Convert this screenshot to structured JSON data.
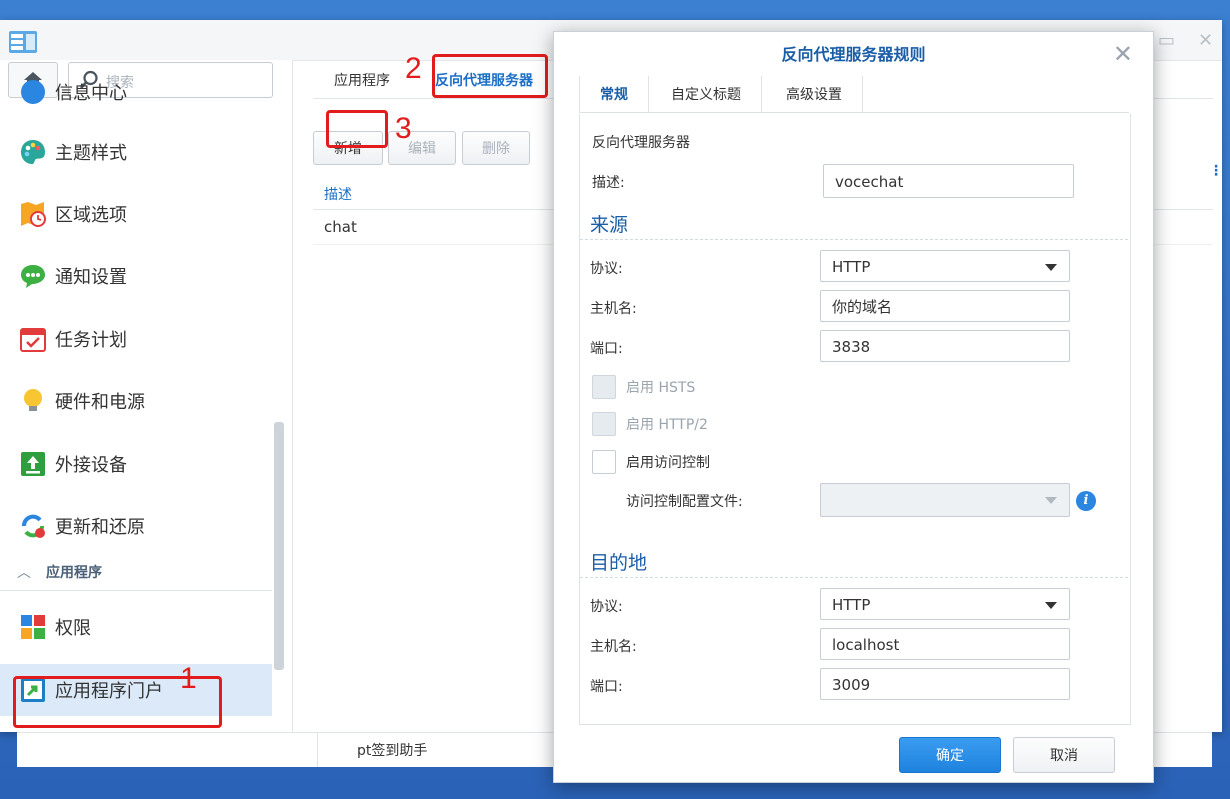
{
  "window": {
    "controls": {
      "minimize": "▭",
      "close": "✕"
    }
  },
  "sidebar": {
    "search_placeholder": "搜索",
    "items": [
      {
        "label": "信息中心",
        "icon": "info-center-icon"
      },
      {
        "label": "主题样式",
        "icon": "palette-icon"
      },
      {
        "label": "区域选项",
        "icon": "region-map-icon"
      },
      {
        "label": "通知设置",
        "icon": "chat-bubble-icon"
      },
      {
        "label": "任务计划",
        "icon": "calendar-check-icon"
      },
      {
        "label": "硬件和电源",
        "icon": "lightbulb-icon"
      },
      {
        "label": "外接设备",
        "icon": "external-device-icon"
      },
      {
        "label": "更新和还原",
        "icon": "update-restore-icon"
      }
    ],
    "group_label": "应用程序",
    "group_items": [
      {
        "label": "权限",
        "icon": "grid-apps-icon"
      },
      {
        "label": "应用程序门户",
        "icon": "app-portal-icon",
        "active": true
      }
    ]
  },
  "content": {
    "tabs": [
      {
        "label": "应用程序"
      },
      {
        "label": "反向代理服务器",
        "active": true
      }
    ],
    "toolbar": {
      "add": "新增",
      "edit": "编辑",
      "delete": "删除"
    },
    "grid": {
      "column_header": "描述",
      "rows": [
        {
          "description": "chat"
        }
      ],
      "column_menu_icon": "⋮"
    }
  },
  "background_window": {
    "item": "pt签到助手"
  },
  "annotations": {
    "n1": "1",
    "n2": "2",
    "n3": "3",
    "color": "#e21c1c"
  },
  "modal": {
    "title": "反向代理服务器规则",
    "close": "✕",
    "tabs": [
      {
        "label": "常规",
        "active": true
      },
      {
        "label": "自定义标题"
      },
      {
        "label": "高级设置"
      }
    ],
    "intro": "反向代理服务器",
    "description_label": "描述:",
    "description_value": "vocechat",
    "source": {
      "heading": "来源",
      "protocol_label": "协议:",
      "protocol_value": "HTTP",
      "hostname_label": "主机名:",
      "hostname_value": "你的域名",
      "port_label": "端口:",
      "port_value": "3838",
      "hsts_label": "启用 HSTS",
      "http2_label": "启用 HTTP/2",
      "access_control_label": "启用访问控制",
      "access_profile_label": "访问控制配置文件:",
      "access_profile_value": ""
    },
    "destination": {
      "heading": "目的地",
      "protocol_label": "协议:",
      "protocol_value": "HTTP",
      "hostname_label": "主机名:",
      "hostname_value": "localhost",
      "port_label": "端口:",
      "port_value": "3009"
    },
    "buttons": {
      "ok": "确定",
      "cancel": "取消"
    },
    "accent_color": "#1b5ea8"
  }
}
